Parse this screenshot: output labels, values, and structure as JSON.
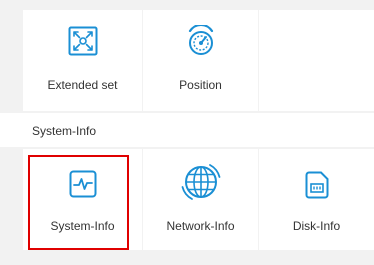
{
  "top_row": {
    "extended_set": {
      "label": "Extended set",
      "icon": "expand-arrows-icon"
    },
    "position": {
      "label": "Position",
      "icon": "speedometer-icon"
    }
  },
  "section": {
    "title": "System-Info"
  },
  "bottom_row": {
    "system_info": {
      "label": "System-Info",
      "icon": "pulse-monitor-icon"
    },
    "network_info": {
      "label": "Network-Info",
      "icon": "globe-network-icon"
    },
    "disk_info": {
      "label": "Disk-Info",
      "icon": "disk-card-icon"
    }
  },
  "colors": {
    "accent": "#1a8fd4",
    "highlight": "#e00000",
    "text": "#333333",
    "divider": "#f2f2f2"
  }
}
